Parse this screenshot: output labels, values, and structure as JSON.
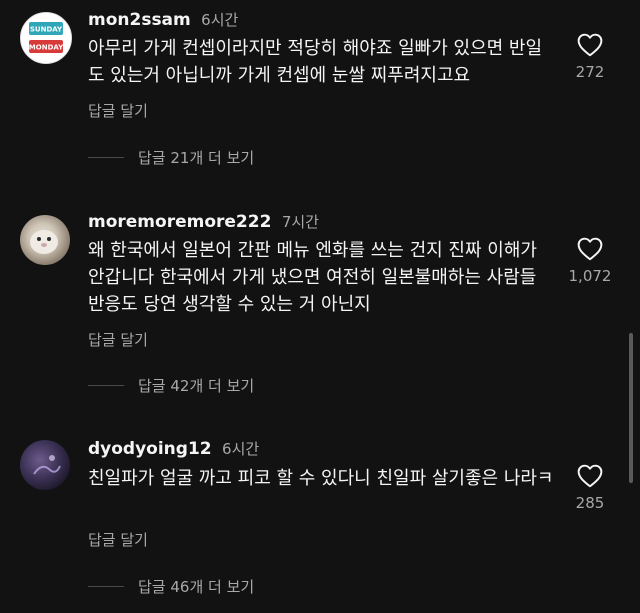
{
  "comments": [
    {
      "username": "mon2ssam",
      "time": "6시간",
      "text": "아무리 가게 컨셉이라지만 적당히 해야죠 일빠가 있으면 반일도 있는거 아닙니까 가게 컨셉에 눈쌀 찌푸려지고요",
      "reply_label": "답글 달기",
      "view_replies": "답글 21개 더 보기",
      "likes": "272",
      "avatar_text_top": "SUNDAY",
      "avatar_text_bottom": "MONDAY"
    },
    {
      "username": "moremoremore222",
      "time": "7시간",
      "text": "왜 한국에서 일본어 간판 메뉴 엔화를 쓰는 건지 진짜 이해가 안갑니다 한국에서 가게 냈으면 여전히 일본불매하는 사람들 반응도 당연 생각할 수 있는 거 아닌지",
      "reply_label": "답글 달기",
      "view_replies": "답글 42개 더 보기",
      "likes": "1,072"
    },
    {
      "username": "dyodyoing12",
      "time": "6시간",
      "text": "친일파가 얼굴 까고 피코 할 수 있다니 친일파 살기좋은 나라ㅋ",
      "reply_label": "답글 달기",
      "view_replies": "답글 46개 더 보기",
      "likes": "285"
    }
  ],
  "colors": {
    "background": "#121212",
    "primary_text": "#f5f5f5",
    "secondary_text": "#a8a8a8"
  },
  "icons": [
    "heart-icon"
  ]
}
